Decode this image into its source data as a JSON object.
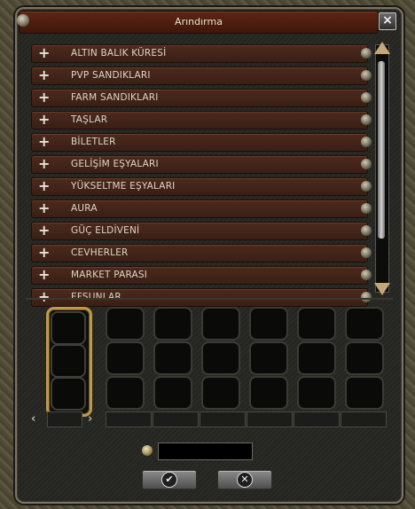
{
  "window": {
    "title": "Arındırma"
  },
  "list": {
    "items": [
      {
        "label": "ALTIN BALIK KÜRESİ"
      },
      {
        "label": "PVP SANDIKLARI"
      },
      {
        "label": "FARM SANDIKLARI"
      },
      {
        "label": "TAŞLAR"
      },
      {
        "label": "BİLETLER"
      },
      {
        "label": "GELİŞİM EŞYALARI"
      },
      {
        "label": "YÜKSELTME EŞYALARI"
      },
      {
        "label": "AURA"
      },
      {
        "label": "GÜÇ ELDİVENİ"
      },
      {
        "label": "CEVHERLER"
      },
      {
        "label": "MARKET PARASI"
      },
      {
        "label": "EFSUNLAR"
      }
    ],
    "expand_glyph": "+"
  },
  "footer": {
    "price_value": "",
    "confirm_glyph": "✔",
    "cancel_glyph": "✕"
  },
  "nav": {
    "prev": "‹",
    "next": "›"
  },
  "colors": {
    "row": "#4c2a1d",
    "title": "#5e2614",
    "highlight": "#c29a46"
  }
}
